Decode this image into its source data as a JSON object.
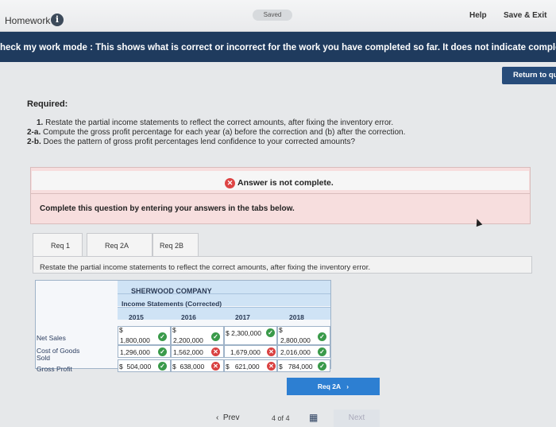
{
  "header": {
    "title": "Homework",
    "info_icon": "i",
    "saved": "Saved",
    "help": "Help",
    "save_exit": "Save & Exit"
  },
  "banner": {
    "text": "heck my work mode : This shows what is correct or incorrect for the work you have completed so far. It does not indicate completio"
  },
  "return_button": "Return to qu",
  "required": {
    "title": "Required:",
    "items": [
      {
        "num": "1.",
        "text": " Restate the partial income statements to reflect the correct amounts, after fixing the inventory error."
      },
      {
        "num": "2-a.",
        "text": " Compute the gross profit percentage for each year (a) before the correction and (b) after the correction."
      },
      {
        "num": "2-b.",
        "text": " Does the pattern of gross profit percentages lend confidence to your corrected amounts?"
      }
    ]
  },
  "answer_status": "Answer is not complete.",
  "complete_prompt": "Complete this question by entering your answers in the tabs below.",
  "tabs": {
    "req1": "Req 1",
    "req2a": "Req 2A",
    "req2b": "Req 2B"
  },
  "restate_text": "Restate the partial income statements to reflect the correct amounts, after fixing the inventory error.",
  "table": {
    "company": "SHERWOOD COMPANY",
    "subtitle": "Income Statements (Corrected)",
    "years": [
      "2015",
      "2016",
      "2017",
      "2018"
    ],
    "rows": {
      "net_sales": {
        "label": "Net Sales",
        "values": [
          "1,800,000",
          "2,200,000",
          "2,300,000",
          "2,800,000"
        ],
        "status": [
          "ok",
          "ok",
          "ok",
          "ok"
        ]
      },
      "cogs": {
        "label": "Cost of Goods Sold",
        "values": [
          "1,296,000",
          "1,562,000",
          "1,679,000",
          "2,016,000"
        ],
        "status": [
          "ok",
          "bad",
          "bad",
          "ok"
        ]
      },
      "gross_profit": {
        "label": "Gross Profit",
        "values": [
          "504,000",
          "638,000",
          "621,000",
          "784,000"
        ],
        "status": [
          "ok",
          "bad",
          "bad",
          "ok"
        ]
      }
    },
    "currency": "$"
  },
  "next_tab_button": "Req 2A",
  "nav": {
    "prev": "Prev",
    "page": "4",
    "of": "of",
    "total": "4",
    "next": "Next"
  }
}
